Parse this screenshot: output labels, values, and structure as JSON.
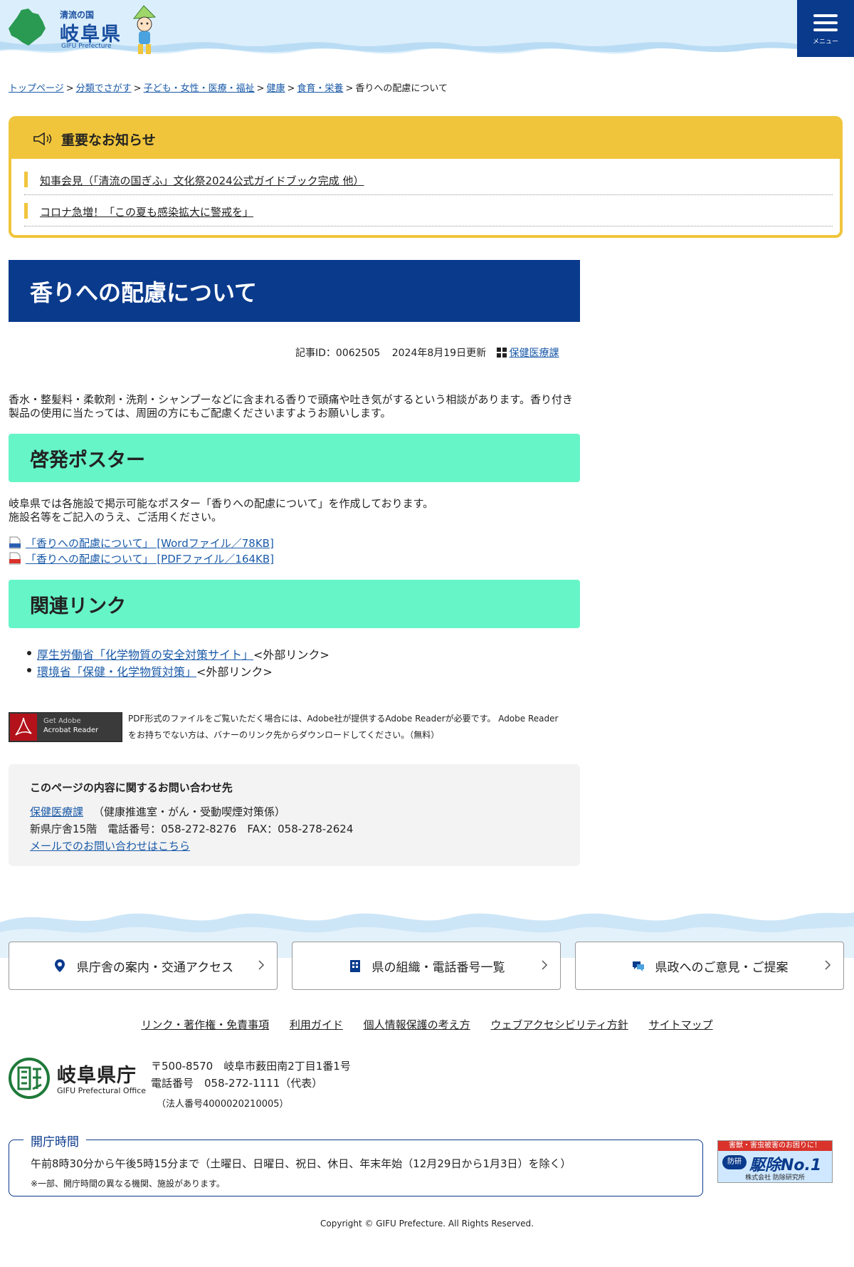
{
  "header": {
    "logo_small": "清流の国",
    "logo_main": "岐阜県",
    "logo_en": "GIFU Prefecture",
    "menu_label": "メニュー"
  },
  "breadcrumb": [
    {
      "label": "トップページ",
      "link": true
    },
    {
      "label": "分類でさがす",
      "link": true
    },
    {
      "label": "子ども・女性・医療・福祉",
      "link": true
    },
    {
      "label": "健康",
      "link": true
    },
    {
      "label": "食育・栄養",
      "link": true
    },
    {
      "label": "香りへの配慮について",
      "link": false
    }
  ],
  "notice": {
    "title": "重要なお知らせ",
    "items": [
      "知事会見（「清流の国ぎふ」文化祭2024公式ガイドブック完成 他）",
      "コロナ急増！「この夏も感染拡大に警戒を」"
    ]
  },
  "page_title": "香りへの配慮について",
  "meta": {
    "article_id": "記事ID：0062505",
    "updated": "2024年8月19日更新",
    "department": "保健医療課"
  },
  "intro": "香水・整髪料・柔軟剤・洗剤・シャンプーなどに含まれる香りで頭痛や吐き気がするという相談があります。香り付き製品の使用に当たっては、周囲の方にもご配慮くださいますようお願いします。",
  "poster_section": {
    "heading": "啓発ポスター",
    "text_1": "岐阜県では各施設で掲示可能なポスター「香りへの配慮について」を作成しております。",
    "text_2": "施設名等をご記入のうえ、ご活用ください。",
    "files": [
      {
        "label": "「香りへの配慮について」 [Wordファイル／78KB]",
        "icon": "word-file-icon",
        "color": "#2b5fb3"
      },
      {
        "label": "「香りへの配慮について」 [PDFファイル／164KB]",
        "icon": "pdf-file-icon",
        "color": "#d9332b"
      }
    ]
  },
  "related_section": {
    "heading": "関連リンク",
    "links": [
      {
        "label": "厚生労働省「化学物質の安全対策サイト」",
        "suffix": "<外部リンク>"
      },
      {
        "label": "環境省「保健・化学物質対策」",
        "suffix": "<外部リンク>"
      }
    ]
  },
  "adobe": {
    "button_line1": "Get Adobe",
    "button_line2": "Acrobat Reader",
    "note": "PDF形式のファイルをご覧いただく場合には、Adobe社が提供するAdobe Readerが必要です。 Adobe Readerをお持ちでない方は、バナーのリンク先からダウンロードしてください。（無料）"
  },
  "contact": {
    "heading": "このページの内容に関するお問い合わせ先",
    "department": "保健医療課",
    "section": "（健康推進室・がん・受動喫煙対策係）",
    "location_phone": "新県庁舎15階　電話番号：058-272-8276　FAX：058-278-2624",
    "mail_link": "メールでのお問い合わせはこちら"
  },
  "footer_buttons": [
    {
      "label": "県庁舎の案内・交通アクセス",
      "icon": "map-pin-icon"
    },
    {
      "label": "県の組織・電話番号一覧",
      "icon": "building-icon"
    },
    {
      "label": "県政へのご意見・ご提案",
      "icon": "chat-icon"
    }
  ],
  "footer_links": [
    "リンク・著作権・免責事項",
    "利用ガイド",
    "個人情報保護の考え方",
    "ウェブアクセシビリティ方針",
    "サイトマップ"
  ],
  "office": {
    "name": "岐阜県庁",
    "name_en": "GIFU Prefectural Office",
    "address": "〒500-8570　岐阜市薮田南2丁目1番1号",
    "phone": "電話番号　058-272-1111（代表）",
    "corp_number": "（法人番号4000020210005）"
  },
  "hours": {
    "label": "開庁時間",
    "line1": "午前8時30分から午後5時15分まで（土曜日、日曜日、祝日、休日、年末年始（12月29日から1月3日）を除く）",
    "line2": "※一部、開庁時間の異なる機関、施設があります。"
  },
  "banner": {
    "top": "害獣・害虫被害のお困りに！",
    "badge": "防研",
    "main": "駆除No.1",
    "company": "株式会社 防除研究所"
  },
  "copyright": "Copyright © GIFU Prefecture. All Rights Reserved.",
  "colors": {
    "navy": "#0a3a8c",
    "notice_yellow": "#f0c53b",
    "section_mint": "#66f5c6",
    "link_blue": "#1a5aa8"
  }
}
